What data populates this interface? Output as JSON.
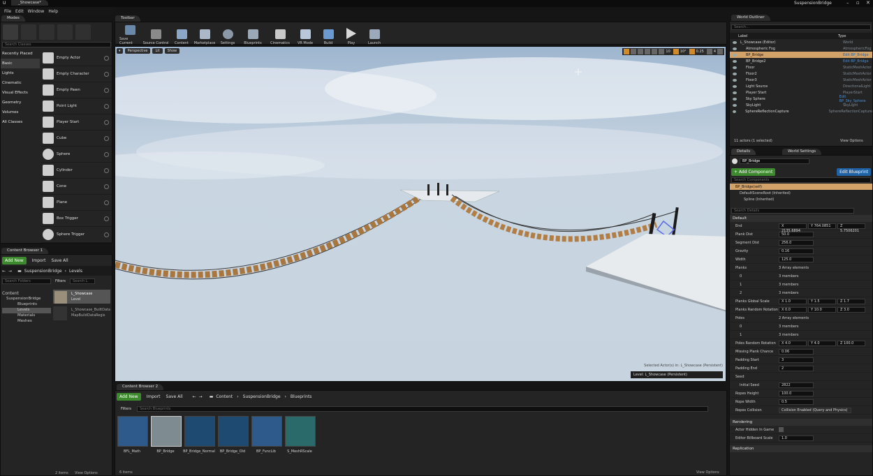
{
  "window": {
    "tab": "_Showcase*",
    "project": "SuspensionBridge"
  },
  "menu": [
    "File",
    "Edit",
    "Window",
    "Help"
  ],
  "modes": {
    "tab": "Modes",
    "search_placeholder": "Search Classes",
    "categories": [
      "Recently Placed",
      "Basic",
      "Lights",
      "Cinematic",
      "Visual Effects",
      "Geometry",
      "Volumes",
      "All Classes"
    ],
    "items": [
      "Empty Actor",
      "Empty Character",
      "Empty Pawn",
      "Point Light",
      "Player Start",
      "Cube",
      "Sphere",
      "Cylinder",
      "Cone",
      "Plane",
      "Box Trigger",
      "Sphere Trigger"
    ]
  },
  "toolbar": {
    "tab": "Toolbar",
    "buttons": [
      "Save Current",
      "Source Control",
      "Content",
      "Marketplace",
      "Settings",
      "Blueprints",
      "Cinematics",
      "VR Mode",
      "Build",
      "Play",
      "Launch"
    ]
  },
  "viewport": {
    "perspective": "Perspective",
    "lit": "Lit",
    "show": "Show",
    "grid": "10",
    "angle": "10°",
    "scale": "0.25",
    "cam": "4",
    "selected": "Selected Actor(s) in: L_Showcase (Persistent)",
    "level": "Level: L_Showcase (Persistent)"
  },
  "outliner": {
    "tab": "World Outliner",
    "search_placeholder": "Search...",
    "col_label": "Label",
    "col_type": "Type",
    "rows": [
      [
        "L_Showcase (Editor)",
        "World"
      ],
      [
        "Atmospheric Fog",
        "AtmosphericFog"
      ],
      [
        "BP_Bridge",
        "Edit BP_Bridge"
      ],
      [
        "BP_Bridge2",
        "Edit BP_Bridge"
      ],
      [
        "Floor",
        "StaticMeshActor"
      ],
      [
        "Floor2",
        "StaticMeshActor"
      ],
      [
        "Floor3",
        "StaticMeshActor"
      ],
      [
        "Light Source",
        "DirectionalLight"
      ],
      [
        "Player Start",
        "PlayerStart"
      ],
      [
        "Sky Sphere",
        "Edit BP_Sky_Sphere"
      ],
      [
        "SkyLight",
        "SkyLight"
      ],
      [
        "SphereReflectionCapture",
        "SphereReflectionCapture"
      ]
    ],
    "status": "11 actors (1 selected)",
    "view_options": "View Options"
  },
  "details": {
    "tab": "Details",
    "tab2": "World Settings",
    "name": "BP_Bridge",
    "add_component": "+ Add Component",
    "edit_bp": "Edit Blueprint",
    "search_components": "Search Components",
    "components": [
      "BP_Bridge(self)",
      "DefaultSceneRoot (Inherited)",
      "Spline (Inherited)"
    ],
    "search_details": "Search Details",
    "section": "Default",
    "end": {
      "label": "End",
      "x": "X 2135.6894",
      "y": "Y 764.0851",
      "z": "Z 5.7506201"
    },
    "props": [
      [
        "Plank Dist",
        "50.0"
      ],
      [
        "Segment Dist",
        "256.0"
      ],
      [
        "Gravity",
        "0.16"
      ],
      [
        "Width",
        "125.0"
      ]
    ],
    "planks": {
      "label": "Planks",
      "val": "3 Array elements",
      "items": [
        [
          "0",
          "3 members"
        ],
        [
          "1",
          "3 members"
        ],
        [
          "2",
          "3 members"
        ]
      ]
    },
    "global_scale": {
      "label": "Planks Global Scale",
      "x": "X 1.0",
      "y": "Y 1.5",
      "z": "Z 1.7"
    },
    "random_rot": {
      "label": "Planks Random Rotation",
      "x": "X 0.0",
      "y": "Y 10.0",
      "z": "Z 3.0"
    },
    "poles": {
      "label": "Poles",
      "val": "2 Array elements",
      "items": [
        [
          "0",
          "3 members"
        ],
        [
          "1",
          "3 members"
        ]
      ]
    },
    "poles_rot": {
      "label": "Poles Random Rotation",
      "x": "X 4.0",
      "y": "Y 4.0",
      "z": "Z 100.0"
    },
    "props2": [
      [
        "Missing Plank Chance",
        "0.06"
      ],
      [
        "Padding Start",
        "3"
      ],
      [
        "Padding End",
        "2"
      ]
    ],
    "seed": "Seed",
    "props3": [
      [
        "Initial Seed",
        "2822"
      ],
      [
        "Ropes Height",
        "100.0"
      ],
      [
        "Rope Width",
        "0.5"
      ]
    ],
    "ropes_collision": {
      "label": "Ropes Collision",
      "val": "Collision Enabled (Query and Physics)"
    },
    "rendering": "Rendering",
    "render_props": [
      [
        "Actor Hidden In Game",
        ""
      ],
      [
        "Editor Billboard Scale",
        "1.0"
      ]
    ],
    "replication": "Replication"
  },
  "browser1": {
    "tab": "Content Browser 1",
    "add": "Add New",
    "import": "Import",
    "save": "Save All",
    "path": [
      "SuspensionBridge",
      "Levels"
    ],
    "search_folders": "Search Folders",
    "filters": "Filters",
    "search": "Search L",
    "tree": [
      "Content",
      "SuspensionBridge",
      "Blueprints",
      "Levels",
      "Materials",
      "Meshes"
    ],
    "asset": {
      "name": "L_Showcase",
      "type": "Level",
      "sub": "L_Showcase_BuiltData",
      "sub2": "MapBuildDataRegis"
    },
    "count": "2 items",
    "view_options": "View Options"
  },
  "browser2": {
    "tab": "Content Browser 2",
    "add": "Add New",
    "import": "Import",
    "save": "Save All",
    "path": [
      "Content",
      "SuspensionBridge",
      "Blueprints"
    ],
    "filters": "Filters",
    "search": "Search Blueprints",
    "assets": [
      "BFL_Math",
      "BP_Bridge",
      "BP_Bridge_Normal",
      "BP_Bridge_Old",
      "BP_FuncLib",
      "S_MeshRScale"
    ],
    "count": "6 items",
    "view_options": "View Options"
  }
}
